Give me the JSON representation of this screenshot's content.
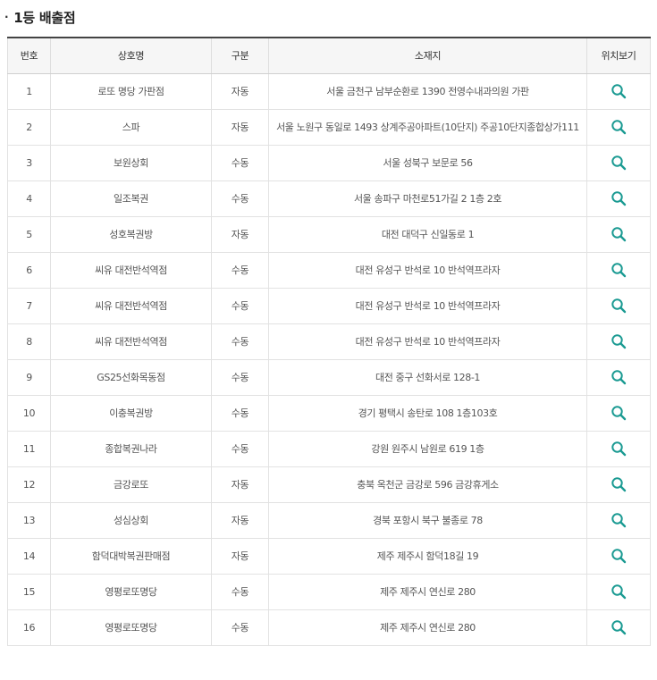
{
  "section": {
    "bullet": "·",
    "title": "1등 배출점"
  },
  "table": {
    "headers": {
      "no": "번호",
      "name": "상호명",
      "type": "구분",
      "address": "소재지",
      "location": "위치보기"
    },
    "rows": [
      {
        "no": "1",
        "name": "로또 명당 가판점",
        "type": "자동",
        "address": "서울 금천구 남부순환로 1390 전영수내과의원 가판"
      },
      {
        "no": "2",
        "name": "스파",
        "type": "자동",
        "address": "서울 노원구 동일로 1493 상계주공아파트(10단지) 주공10단지종합상가111"
      },
      {
        "no": "3",
        "name": "보원상회",
        "type": "수동",
        "address": "서울 성북구 보문로 56"
      },
      {
        "no": "4",
        "name": "일조복권",
        "type": "수동",
        "address": "서울 송파구 마천로51가길 2 1층 2호"
      },
      {
        "no": "5",
        "name": "성호복권방",
        "type": "자동",
        "address": "대전 대덕구 신일동로 1"
      },
      {
        "no": "6",
        "name": "씨유 대전반석역점",
        "type": "수동",
        "address": "대전 유성구 반석로 10 반석역프라자"
      },
      {
        "no": "7",
        "name": "씨유 대전반석역점",
        "type": "수동",
        "address": "대전 유성구 반석로 10 반석역프라자"
      },
      {
        "no": "8",
        "name": "씨유 대전반석역점",
        "type": "수동",
        "address": "대전 유성구 반석로 10 반석역프라자"
      },
      {
        "no": "9",
        "name": "GS25선화목동점",
        "type": "수동",
        "address": "대전 중구 선화서로 128-1"
      },
      {
        "no": "10",
        "name": "이충복권방",
        "type": "수동",
        "address": "경기 평택시 송탄로 108 1층103호"
      },
      {
        "no": "11",
        "name": "종합복권나라",
        "type": "수동",
        "address": "강원 원주시 남원로 619 1층"
      },
      {
        "no": "12",
        "name": "금강로또",
        "type": "자동",
        "address": "충북 옥천군 금강로 596 금강휴게소"
      },
      {
        "no": "13",
        "name": "성심상회",
        "type": "자동",
        "address": "경북 포항시 북구 불종로 78"
      },
      {
        "no": "14",
        "name": "함덕대박복권판매점",
        "type": "자동",
        "address": "제주 제주시 함덕18길 19"
      },
      {
        "no": "15",
        "name": "영평로또명당",
        "type": "수동",
        "address": "제주 제주시 연신로 280"
      },
      {
        "no": "16",
        "name": "영평로또명당",
        "type": "수동",
        "address": "제주 제주시 연신로 280"
      }
    ]
  },
  "icons": {
    "location": "search-icon"
  },
  "colors": {
    "icon": "#1a9a92",
    "header_top_border": "#444444",
    "header_bg": "#f6f6f6"
  }
}
